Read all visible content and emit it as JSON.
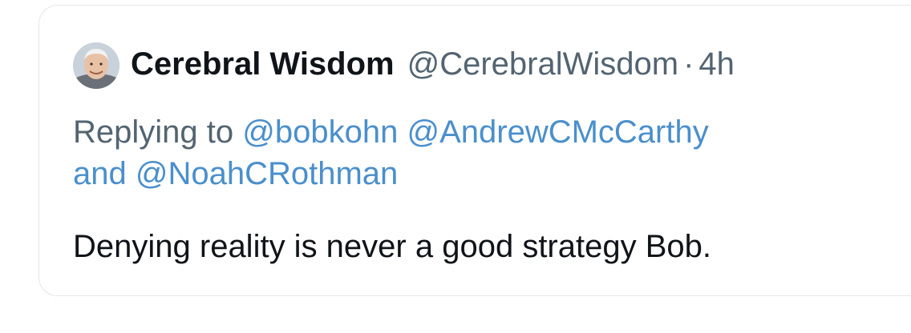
{
  "tweet": {
    "display_name": "Cerebral Wisdom",
    "handle": "@CerebralWisdom",
    "separator": "·",
    "time": "4h",
    "avatar_icon": "profile-avatar-photo",
    "reply": {
      "prefix": "Replying to",
      "mentions": [
        "@bobkohn",
        "@AndrewCMcCarthy",
        "@NoahCRothman"
      ],
      "conjunction": "and"
    },
    "text": "Denying reality is never a good strategy Bob."
  },
  "colors": {
    "text": "#0f1419",
    "secondary": "#536471",
    "mention": "#4a8fcd",
    "border": "#e3e6e9"
  }
}
